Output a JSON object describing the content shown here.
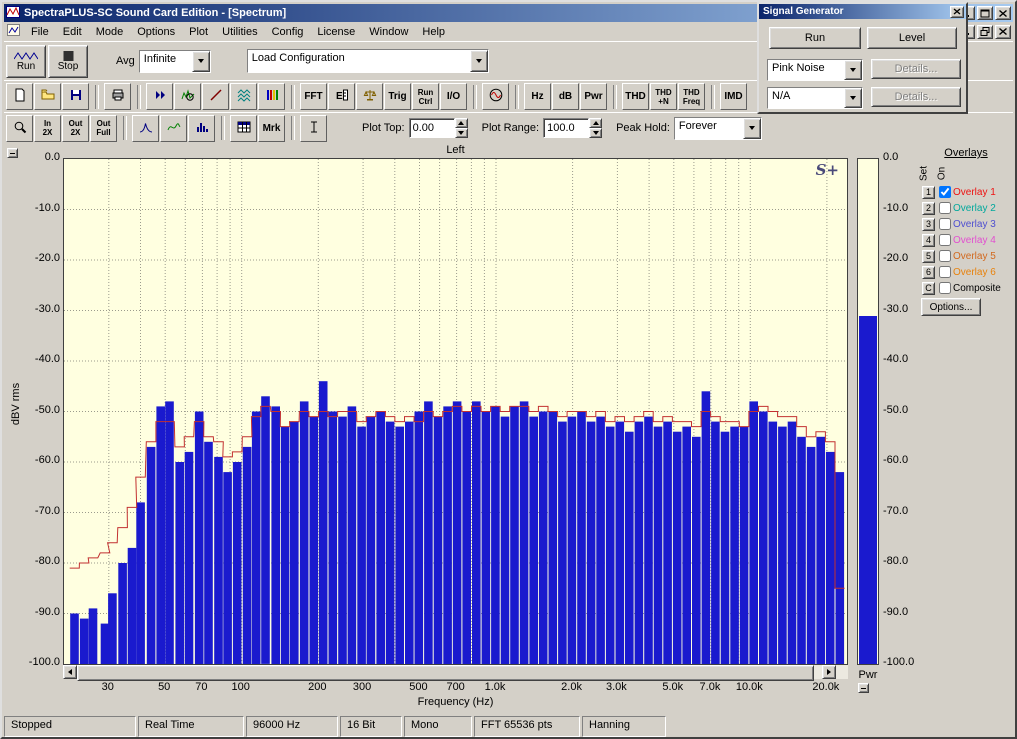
{
  "window": {
    "title": "SpectraPLUS-SC Sound Card Edition - [Spectrum]"
  },
  "menu": {
    "items": [
      "File",
      "Edit",
      "Mode",
      "Options",
      "Plot",
      "Utilities",
      "Config",
      "License",
      "Window",
      "Help"
    ]
  },
  "toolbar1": {
    "run_label": "Run",
    "stop_label": "Stop",
    "avg_label": "Avg",
    "avg_value": "Infinite",
    "config_value": "Load Configuration"
  },
  "toolbar2": {
    "items": [
      {
        "name": "new-file",
        "icon": "new-file"
      },
      {
        "name": "open-file",
        "icon": "open-folder"
      },
      {
        "name": "save-file",
        "icon": "floppy"
      },
      {
        "sep": 1
      },
      {
        "name": "print",
        "icon": "printer"
      },
      {
        "sep": 1
      },
      {
        "name": "time-series-view",
        "icon": "fast-forward"
      },
      {
        "name": "spectrum-view",
        "icon": "spectrum-zoom"
      },
      {
        "name": "phase-view",
        "icon": "diagonal-line"
      },
      {
        "name": "waterfall-view",
        "icon": "waterfall"
      },
      {
        "name": "spectrogram-view",
        "icon": "spectrogram"
      },
      {
        "sep": 1
      },
      {
        "name": "fft-settings",
        "label": "FFT"
      },
      {
        "name": "scaling",
        "icon": "e-scale"
      },
      {
        "name": "calibration",
        "icon": "balance"
      },
      {
        "name": "trigger",
        "label": "Trig"
      },
      {
        "name": "run-control",
        "label": "Run Ctrl",
        "small": 1
      },
      {
        "name": "io-device",
        "label": "I/O"
      },
      {
        "sep": 1
      },
      {
        "name": "signal-generator",
        "icon": "sine-circle"
      },
      {
        "sep": 1
      },
      {
        "name": "hz-units",
        "label": "Hz"
      },
      {
        "name": "db-units",
        "label": "dB"
      },
      {
        "name": "power-units",
        "label": "Pwr"
      },
      {
        "sep": 1
      },
      {
        "name": "thd",
        "label": "THD"
      },
      {
        "name": "thd-n",
        "label": "THD +N",
        "small": 1
      },
      {
        "name": "thd-freq",
        "label": "THD Freq",
        "small": 1
      },
      {
        "sep": 1
      },
      {
        "name": "imd",
        "label": "IMD"
      }
    ]
  },
  "toolbar3": {
    "items": [
      {
        "name": "zoom",
        "icon": "magnifier"
      },
      {
        "name": "zoom-in-2x",
        "label": "In 2X",
        "small": 1
      },
      {
        "name": "zoom-out-2x",
        "label": "Out 2X",
        "small": 1
      },
      {
        "name": "zoom-out-full",
        "label": "Out Full",
        "small": 1
      },
      {
        "sep": 1
      },
      {
        "name": "narrowband-plot",
        "icon": "peak-curve"
      },
      {
        "name": "line-plot",
        "icon": "smooth-curve"
      },
      {
        "name": "bar-plot",
        "icon": "histogram"
      },
      {
        "sep": 1
      },
      {
        "name": "data-table",
        "icon": "grid-table"
      },
      {
        "name": "marker",
        "label": "Mrk"
      },
      {
        "sep": 1
      },
      {
        "name": "cursor-marker",
        "icon": "ibeam"
      }
    ],
    "plot_top_label": "Plot Top:",
    "plot_top_value": "0.00",
    "plot_range_label": "Plot Range:",
    "plot_range_value": "100.0",
    "peak_hold_label": "Peak Hold:",
    "peak_hold_value": "Forever"
  },
  "signal_generator": {
    "title": "Signal Generator",
    "run_label": "Run",
    "level_label": "Level",
    "waveform_value": "Pink Noise",
    "aux_value": "N/A",
    "details_label": "Details..."
  },
  "plot": {
    "title": "Left",
    "ylabel": "dBV rms",
    "xlabel": "Frequency (Hz)",
    "logo": "S+",
    "pwr_label": "Pwr"
  },
  "overlays": {
    "title": "Overlays",
    "set_label": "Set",
    "on_label": "On",
    "options_label": "Options...",
    "rows": [
      {
        "btn": "1",
        "label": "Overlay 1",
        "color": "#ee1111",
        "checked": true
      },
      {
        "btn": "2",
        "label": "Overlay 2",
        "color": "#00a89c",
        "checked": false
      },
      {
        "btn": "3",
        "label": "Overlay 3",
        "color": "#4f4fd0",
        "checked": false
      },
      {
        "btn": "4",
        "label": "Overlay 4",
        "color": "#e24fd0",
        "checked": false
      },
      {
        "btn": "5",
        "label": "Overlay 5",
        "color": "#d2691e",
        "checked": false
      },
      {
        "btn": "6",
        "label": "Overlay 6",
        "color": "#e8820c",
        "checked": false
      },
      {
        "btn": "C",
        "label": "Composite",
        "color": "#000000",
        "checked": false
      }
    ]
  },
  "status": {
    "items": [
      "Stopped",
      "Real Time",
      "96000 Hz",
      "16 Bit",
      "Mono",
      "FFT 65536 pts",
      "Hanning"
    ]
  },
  "chart_data": {
    "type": "bar",
    "title": "Left",
    "xlabel": "Frequency (Hz)",
    "ylabel": "dBV rms",
    "x_log": true,
    "xlim": [
      20,
      24000
    ],
    "ylim": [
      -100,
      0
    ],
    "grid": true,
    "bar_color": "#1a1ace",
    "overlay_color": "#c23030",
    "freqs": [
      22,
      24,
      26,
      29,
      31,
      34,
      37,
      40,
      44,
      48,
      52,
      57,
      62,
      68,
      74,
      81,
      88,
      96,
      105,
      114,
      124,
      136,
      148,
      161,
      176,
      192,
      209,
      228,
      249,
      271,
      296,
      322,
      352,
      383,
      418,
      456,
      497,
      542,
      591,
      645,
      703,
      767,
      836,
      912,
      994,
      1084,
      1182,
      1289,
      1406,
      1533,
      1672,
      1823,
      1988,
      2168,
      2364,
      2578,
      2811,
      3066,
      3343,
      3646,
      3976,
      4335,
      4728,
      5156,
      5622,
      6131,
      6686,
      7291,
      7951,
      8670,
      9455,
      10310,
      11243,
      12260,
      13370,
      14580,
      15900,
      17338,
      18906,
      20617,
      22483
    ],
    "values": [
      -90,
      -91,
      -89,
      -92,
      -86,
      -80,
      -77,
      -68,
      -57,
      -49,
      -48,
      -60,
      -58,
      -50,
      -56,
      -59,
      -62,
      -60,
      -57,
      -50,
      -47,
      -49,
      -53,
      -52,
      -48,
      -51,
      -44,
      -50,
      -51,
      -49,
      -53,
      -51,
      -50,
      -52,
      -53,
      -52,
      -50,
      -48,
      -51,
      -49,
      -48,
      -50,
      -48,
      -50,
      -49,
      -51,
      -49,
      -48,
      -51,
      -50,
      -50,
      -52,
      -51,
      -50,
      -52,
      -51,
      -53,
      -52,
      -54,
      -52,
      -51,
      -53,
      -52,
      -54,
      -53,
      -55,
      -46,
      -52,
      -54,
      -53,
      -53,
      -48,
      -50,
      -52,
      -53,
      -52,
      -55,
      -57,
      -55,
      -58,
      -62
    ],
    "overlay_series_name": "Overlay 1 (peak hold)",
    "overlay_values": [
      -81,
      -80,
      -79,
      -78,
      -76,
      -73,
      -69,
      -63,
      -56,
      -52,
      -52,
      -57,
      -55,
      -52,
      -55,
      -56,
      -59,
      -58,
      -55,
      -51,
      -49,
      -50,
      -53,
      -52,
      -50,
      -51,
      -50,
      -51,
      -50,
      -50,
      -52,
      -51,
      -50,
      -51,
      -52,
      -51,
      -52,
      -50,
      -51,
      -50,
      -49,
      -50,
      -49,
      -50,
      -49,
      -50,
      -49,
      -49,
      -50,
      -49,
      -50,
      -51,
      -50,
      -50,
      -51,
      -50,
      -52,
      -51,
      -52,
      -51,
      -50,
      -52,
      -51,
      -52,
      -52,
      -53,
      -50,
      -51,
      -52,
      -52,
      -53,
      -50,
      -49,
      -50,
      -51,
      -51,
      -53,
      -55,
      -54,
      -56,
      -85
    ],
    "grid_freqs": [
      30,
      40,
      50,
      60,
      70,
      80,
      90,
      100,
      200,
      300,
      400,
      500,
      600,
      700,
      800,
      900,
      1000,
      2000,
      3000,
      4000,
      5000,
      6000,
      7000,
      8000,
      9000,
      10000,
      20000
    ],
    "x_ticks": [
      {
        "f": 30,
        "label": "30"
      },
      {
        "f": 50,
        "label": "50"
      },
      {
        "f": 70,
        "label": "70"
      },
      {
        "f": 100,
        "label": "100"
      },
      {
        "f": 200,
        "label": "200"
      },
      {
        "f": 300,
        "label": "300"
      },
      {
        "f": 500,
        "label": "500"
      },
      {
        "f": 700,
        "label": "700"
      },
      {
        "f": 1000,
        "label": "1.0k"
      },
      {
        "f": 2000,
        "label": "2.0k"
      },
      {
        "f": 3000,
        "label": "3.0k"
      },
      {
        "f": 5000,
        "label": "5.0k"
      },
      {
        "f": 7000,
        "label": "7.0k"
      },
      {
        "f": 10000,
        "label": "10.0k"
      },
      {
        "f": 20000,
        "label": "20.0k"
      }
    ],
    "y_ticks": [
      {
        "v": 0,
        "label": "0.0"
      },
      {
        "v": -10,
        "label": "-10.0"
      },
      {
        "v": -20,
        "label": "-20.0"
      },
      {
        "v": -30,
        "label": "-30.0"
      },
      {
        "v": -40,
        "label": "-40.0"
      },
      {
        "v": -50,
        "label": "-50.0"
      },
      {
        "v": -60,
        "label": "-60.0"
      },
      {
        "v": -70,
        "label": "-70.0"
      },
      {
        "v": -80,
        "label": "-80.0"
      },
      {
        "v": -90,
        "label": "-90.0"
      },
      {
        "v": -100,
        "label": "-100.0"
      }
    ],
    "pwr_value": -31
  }
}
